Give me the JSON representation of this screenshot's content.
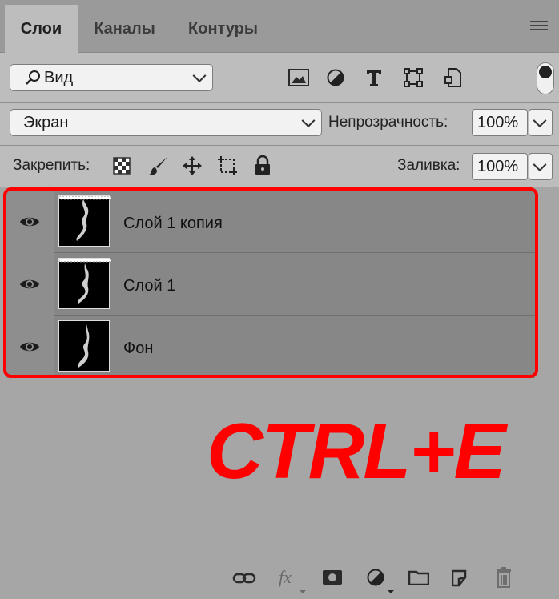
{
  "tabs": [
    {
      "label": "Слои",
      "active": true
    },
    {
      "label": "Каналы",
      "active": false
    },
    {
      "label": "Контуры",
      "active": false
    }
  ],
  "filter": {
    "label": "Вид"
  },
  "filter_icons": [
    "image-filter-icon",
    "adjustment-filter-icon",
    "type-filter-icon",
    "shape-filter-icon",
    "smart-object-filter-icon"
  ],
  "blend": {
    "mode": "Экран",
    "opacity_label": "Непрозрачность:",
    "opacity_value": "100%"
  },
  "lock": {
    "label": "Закрепить:",
    "fill_label": "Заливка:",
    "fill_value": "100%"
  },
  "layers": [
    {
      "name": "Слой 1 копия"
    },
    {
      "name": "Слой 1"
    },
    {
      "name": "Фон"
    }
  ],
  "overlay_text": "CTRL+E",
  "bottom": {
    "fx_label": "fx"
  },
  "colors": {
    "highlight": "#ff0000",
    "panel": "#bdbdbd",
    "layer_bg": "#878787"
  }
}
